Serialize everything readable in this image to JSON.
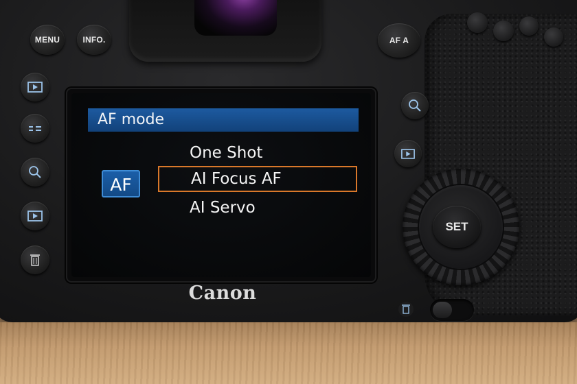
{
  "camera": {
    "brand": "Canon",
    "top_buttons": {
      "menu_label": "MENU",
      "info_label": "INFO.",
      "af_label": "AF A"
    },
    "set_label": "SET"
  },
  "screen": {
    "menu_title": "AF mode",
    "badge": "AF",
    "options": [
      {
        "label": "One Shot",
        "selected": false
      },
      {
        "label": "AI Focus AF",
        "selected": true
      },
      {
        "label": "AI Servo",
        "selected": false
      }
    ],
    "colors": {
      "title_bar": "#1d5aa0",
      "selection_border": "#d9782a",
      "badge_border": "#3e8cd6"
    }
  },
  "icons": {
    "left_column": [
      "playback-icon",
      "flash-info-icon",
      "magnify-icon",
      "playback-icon",
      "trash-icon"
    ],
    "right_column": [
      "magnify-icon",
      "playback-icon",
      "trash-icon"
    ]
  }
}
